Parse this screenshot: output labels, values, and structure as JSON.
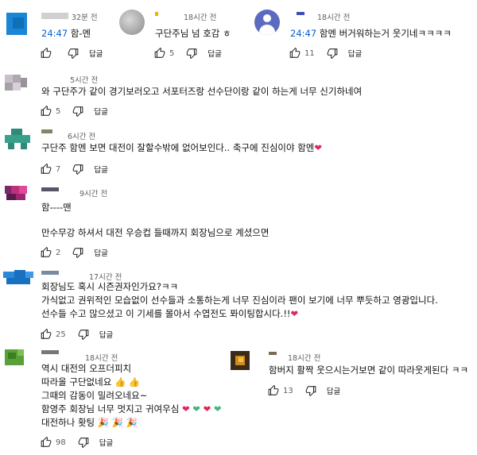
{
  "icons": {
    "like": "thumb-up-icon",
    "dislike": "thumb-down-icon"
  },
  "colors": {
    "timestamp_link": "#065fd4",
    "meta": "#606060",
    "heart": "#e0245e",
    "green_heart": "#43b581"
  },
  "reply_label": "답글",
  "comments": [
    {
      "id": "c1",
      "time": "32분 전",
      "timestamp": "24:47",
      "text": "함-멘",
      "likes": "",
      "avatar": "blue-square"
    },
    {
      "id": "c2",
      "time": "18시간 전",
      "timestamp": "",
      "text": "구단주님 넘 호감 ㅎ",
      "likes": "5",
      "avatar": "gray-circle"
    },
    {
      "id": "c3",
      "time": "18시간 전",
      "timestamp": "24:47",
      "text": "함멘 버거워하는거 웃기네ㅋㅋㅋㅋ",
      "likes": "11",
      "avatar": "purple-person"
    },
    {
      "id": "c4",
      "time": "5시간 전",
      "text": "와 구단주가 같이 경기보러오고  서포터즈랑 선수단이랑 같이 하는게 너무 신기하네여",
      "likes": "5"
    },
    {
      "id": "c5",
      "time": "6시간 전",
      "text": "구단주 함멘 보면 대전이 잘할수밖에 없어보인다.. 축구에 진심이야 함멘",
      "likes": "7"
    },
    {
      "id": "c6",
      "time": "9시간 전",
      "line1": "함----맨",
      "line2": "만수무강 하셔서 대전 우승컵 들때까지 회장님으로 계셨으면",
      "likes": "2"
    },
    {
      "id": "c7",
      "time": "17시간 전",
      "lines": [
        "회장님도 혹시 시즌권자인가요?ㅋㅋ",
        "가식없고 권위적인 모습없이 선수들과 소통하는게 너무 진심이라 팬이 보기에 너무 뿌듯하고 영광입니다.",
        "선수들 수고 많으셨고 이 기세를 몰아서 수엽전도 퐈이팅합시다.!!"
      ],
      "likes": "25"
    },
    {
      "id": "c8",
      "time": "18시간 전",
      "lines": [
        "역시 대전의 오프더피치",
        "따라올 구단없네요",
        "그때의 감동이 밀려오네요~",
        "함영주 회장님 너무 멋지고 귀여우심",
        "대전하나 홧팅"
      ],
      "likes": "98"
    },
    {
      "id": "c9",
      "time": "18시간 전",
      "text": "함버지 활짝 웃으시는거보면 같이 따라웃게된다 ㅋㅋ",
      "likes": "13"
    }
  ]
}
